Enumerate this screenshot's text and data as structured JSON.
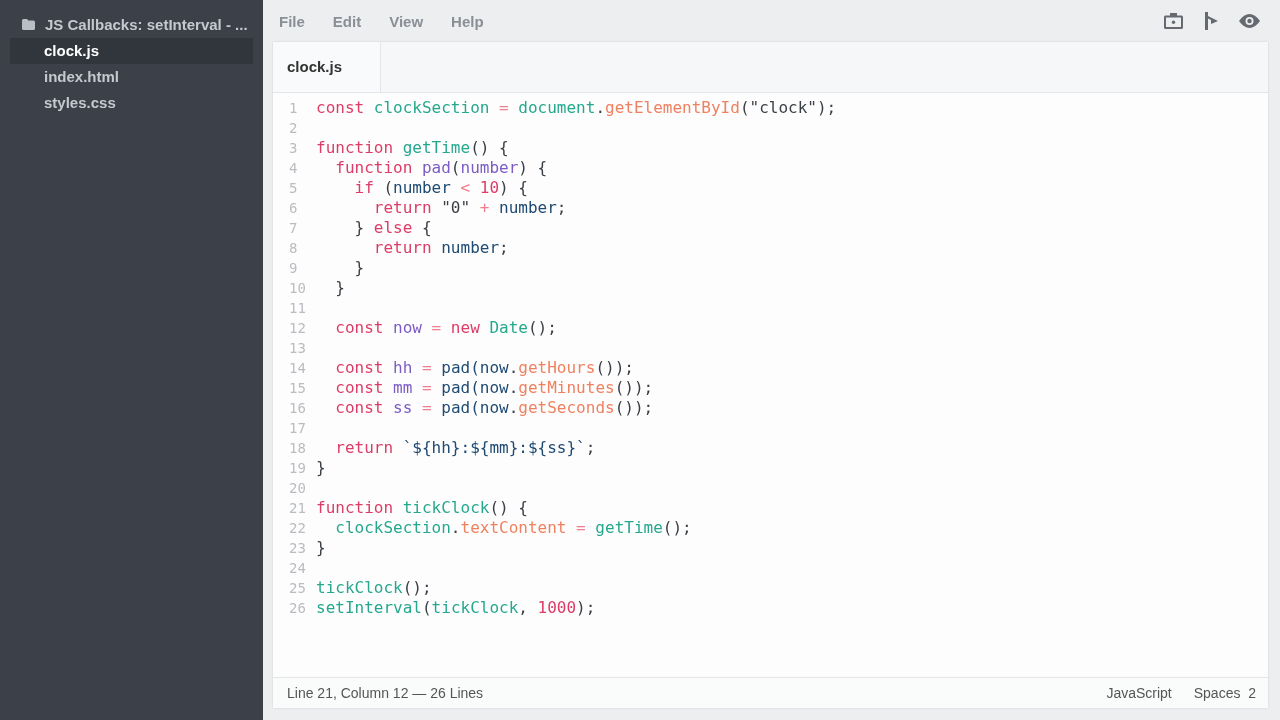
{
  "sidebar": {
    "folder": {
      "label": "JS Callbacks: setInterval - ..."
    },
    "files": [
      {
        "label": "clock.js",
        "selected": true
      },
      {
        "label": "index.html",
        "selected": false
      },
      {
        "label": "styles.css",
        "selected": false
      }
    ]
  },
  "menu": [
    "File",
    "Edit",
    "View",
    "Help"
  ],
  "toolbar": [
    {
      "kind": "camera"
    },
    {
      "kind": "share"
    },
    {
      "kind": "preview"
    }
  ],
  "tabs": [
    {
      "label": "clock.js",
      "selected": true
    }
  ],
  "code": [
    {
      "number": "1",
      "tokens": [
        {
          "kind": "keyword",
          "text": "const"
        },
        {
          "kind": "func",
          "text": " clockSection"
        },
        {
          "kind": "op",
          "text": " ="
        },
        {
          "kind": "func",
          "text": " document"
        },
        {
          "kind": "plain",
          "text": "."
        },
        {
          "kind": "prop",
          "text": "getElementById"
        },
        {
          "kind": "plain",
          "text": "(\"clock\");"
        }
      ]
    },
    {
      "number": "2"
    },
    {
      "number": "3",
      "tokens": [
        {
          "kind": "keyword",
          "text": "function"
        },
        {
          "kind": "func",
          "text": " getTime"
        },
        {
          "kind": "plain",
          "text": "() {"
        }
      ]
    },
    {
      "number": "4",
      "tokens": [
        {
          "kind": "keyword",
          "text": "  function"
        },
        {
          "kind": "param",
          "text": " pad"
        },
        {
          "kind": "plain",
          "text": "("
        },
        {
          "kind": "param",
          "text": "number"
        },
        {
          "kind": "plain",
          "text": ") {"
        }
      ]
    },
    {
      "number": "5",
      "tokens": [
        {
          "kind": "keyword",
          "text": "    if"
        },
        {
          "kind": "plain",
          "text": " ("
        },
        {
          "kind": "var",
          "text": "number"
        },
        {
          "kind": "op",
          "text": " <"
        },
        {
          "kind": "number",
          "text": " 10"
        },
        {
          "kind": "plain",
          "text": ") {"
        }
      ]
    },
    {
      "number": "6",
      "tokens": [
        {
          "kind": "keyword",
          "text": "      return"
        },
        {
          "kind": "plain",
          "text": " \"0\""
        },
        {
          "kind": "op",
          "text": " +"
        },
        {
          "kind": "var",
          "text": " number"
        },
        {
          "kind": "plain",
          "text": ";"
        }
      ]
    },
    {
      "number": "7",
      "tokens": [
        {
          "kind": "plain",
          "text": "    } "
        },
        {
          "kind": "keyword",
          "text": "else"
        },
        {
          "kind": "plain",
          "text": " {"
        }
      ]
    },
    {
      "number": "8",
      "tokens": [
        {
          "kind": "keyword",
          "text": "      return"
        },
        {
          "kind": "var",
          "text": " number"
        },
        {
          "kind": "plain",
          "text": ";"
        }
      ]
    },
    {
      "number": "9",
      "tokens": [
        {
          "kind": "plain",
          "text": "    }"
        }
      ]
    },
    {
      "number": "10",
      "tokens": [
        {
          "kind": "plain",
          "text": "  }"
        }
      ]
    },
    {
      "number": "11"
    },
    {
      "number": "12",
      "tokens": [
        {
          "kind": "keyword",
          "text": "  const"
        },
        {
          "kind": "param",
          "text": " now"
        },
        {
          "kind": "op",
          "text": " ="
        },
        {
          "kind": "keyword",
          "text": " new"
        },
        {
          "kind": "func",
          "text": " Date"
        },
        {
          "kind": "plain",
          "text": "();"
        }
      ]
    },
    {
      "number": "13"
    },
    {
      "number": "14",
      "tokens": [
        {
          "kind": "keyword",
          "text": "  const"
        },
        {
          "kind": "param",
          "text": " hh"
        },
        {
          "kind": "op",
          "text": " ="
        },
        {
          "kind": "var",
          "text": " pad(now"
        },
        {
          "kind": "plain",
          "text": "."
        },
        {
          "kind": "prop",
          "text": "getHours"
        },
        {
          "kind": "plain",
          "text": "());"
        }
      ]
    },
    {
      "number": "15",
      "tokens": [
        {
          "kind": "keyword",
          "text": "  const"
        },
        {
          "kind": "param",
          "text": " mm"
        },
        {
          "kind": "op",
          "text": " ="
        },
        {
          "kind": "var",
          "text": " pad(now"
        },
        {
          "kind": "plain",
          "text": "."
        },
        {
          "kind": "prop",
          "text": "getMinutes"
        },
        {
          "kind": "plain",
          "text": "());"
        }
      ]
    },
    {
      "number": "16",
      "tokens": [
        {
          "kind": "keyword",
          "text": "  const"
        },
        {
          "kind": "param",
          "text": " ss"
        },
        {
          "kind": "op",
          "text": " ="
        },
        {
          "kind": "var",
          "text": " pad(now"
        },
        {
          "kind": "plain",
          "text": "."
        },
        {
          "kind": "prop",
          "text": "getSeconds"
        },
        {
          "kind": "plain",
          "text": "());"
        }
      ]
    },
    {
      "number": "17"
    },
    {
      "number": "18",
      "tokens": [
        {
          "kind": "keyword",
          "text": "  return"
        },
        {
          "kind": "var",
          "text": " `${hh}:${mm}:${ss}`"
        },
        {
          "kind": "plain",
          "text": ";"
        }
      ]
    },
    {
      "number": "19",
      "tokens": [
        {
          "kind": "plain",
          "text": "}"
        }
      ]
    },
    {
      "number": "20"
    },
    {
      "number": "21",
      "tokens": [
        {
          "kind": "keyword",
          "text": "function"
        },
        {
          "kind": "func",
          "text": " tickClock"
        },
        {
          "kind": "plain",
          "text": "() {"
        }
      ]
    },
    {
      "number": "22",
      "tokens": [
        {
          "kind": "func",
          "text": "  clockSection"
        },
        {
          "kind": "plain",
          "text": "."
        },
        {
          "kind": "prop",
          "text": "textContent"
        },
        {
          "kind": "op",
          "text": " ="
        },
        {
          "kind": "func",
          "text": " getTime"
        },
        {
          "kind": "plain",
          "text": "();"
        }
      ]
    },
    {
      "number": "23",
      "tokens": [
        {
          "kind": "plain",
          "text": "}"
        }
      ]
    },
    {
      "number": "24"
    },
    {
      "number": "25",
      "tokens": [
        {
          "kind": "func",
          "text": "tickClock"
        },
        {
          "kind": "plain",
          "text": "();"
        }
      ]
    },
    {
      "number": "26",
      "tokens": [
        {
          "kind": "func",
          "text": "setInterval"
        },
        {
          "kind": "plain",
          "text": "("
        },
        {
          "kind": "func",
          "text": "tickClock"
        },
        {
          "kind": "plain",
          "text": ", "
        },
        {
          "kind": "number",
          "text": "1000"
        },
        {
          "kind": "plain",
          "text": ");"
        }
      ]
    }
  ],
  "status_bar": {
    "position": "Line 21, Column 12 — 26 Lines",
    "language": "JavaScript",
    "indent": "Spaces  2"
  }
}
